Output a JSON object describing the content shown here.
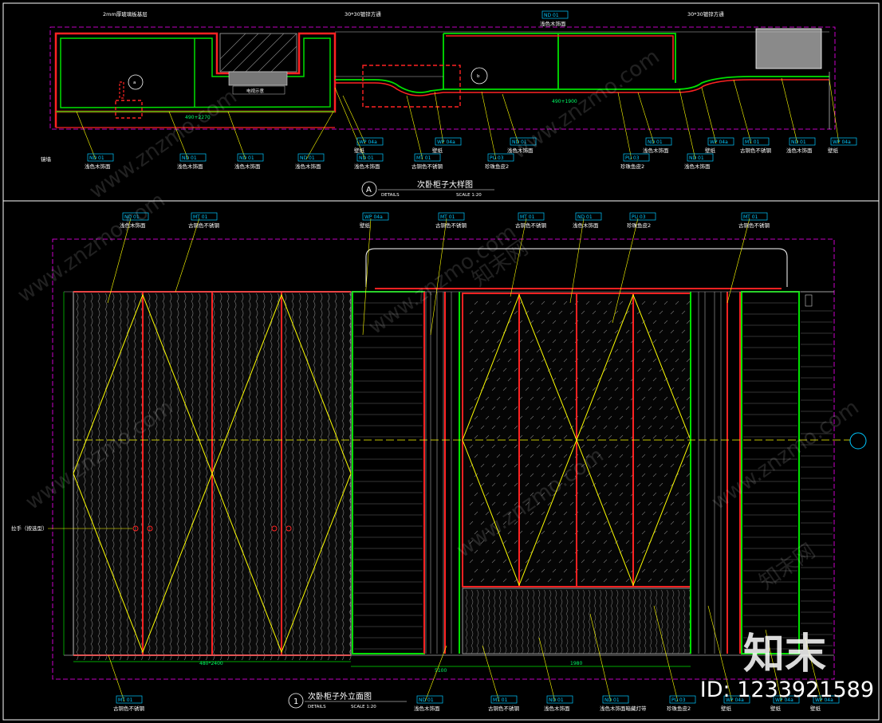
{
  "drawing_a": {
    "title": "次卧柜子大样图",
    "label": "A",
    "details_word": "DETAILS",
    "scale": "SCALE 1:20",
    "top_callouts": [
      "2mm厚玻璃板基层",
      "30*30镀锌方通",
      "30*30镀锌方通"
    ],
    "top_tag": "ND 01",
    "top_tag_text": "浅色木饰面",
    "section_marks": [
      "a",
      "b"
    ],
    "tv_text": "电视示意",
    "dims": [
      "490+2270",
      "490+1900"
    ],
    "left_note": "镜墙",
    "bottom_tags": [
      {
        "code": "ND 01",
        "text": "浅色木饰面"
      },
      {
        "code": "ND 01",
        "text": "浅色木饰面"
      },
      {
        "code": "ND 01",
        "text": "浅色木饰面"
      },
      {
        "code": "ND 01",
        "text": "浅色木饰面"
      },
      {
        "code": "ND 01",
        "text": "浅色木饰面"
      },
      {
        "code": "WP 04a",
        "text": "壁纸"
      },
      {
        "code": "MT 01",
        "text": "古铜色不锈钢"
      },
      {
        "code": "WP 04a",
        "text": "壁纸"
      },
      {
        "code": "PU 03",
        "text": "珍珠鱼皮2"
      },
      {
        "code": "ND 01",
        "text": "浅色木饰面"
      },
      {
        "code": "PU 03",
        "text": "珍珠鱼皮2"
      },
      {
        "code": "ND 01",
        "text": "浅色木饰面"
      },
      {
        "code": "ND 01",
        "text": "浅色木饰面"
      },
      {
        "code": "WP 04a",
        "text": "壁纸"
      },
      {
        "code": "MT 01",
        "text": "古铜色不锈钢"
      },
      {
        "code": "ND 01",
        "text": "浅色木饰面"
      },
      {
        "code": "WP 04a",
        "text": "壁纸"
      }
    ]
  },
  "drawing_1": {
    "title": "次卧柜子外立面图",
    "label": "1",
    "details_word": "DETAILS",
    "scale": "SCALE 1:20",
    "handle_note": "拉手（按选型）",
    "top_tags": [
      {
        "code": "ND 01",
        "text": "浅色木饰面"
      },
      {
        "code": "MT 01",
        "text": "古铜色不锈钢"
      },
      {
        "code": "WP 04a",
        "text": "壁纸"
      },
      {
        "code": "MT 01",
        "text": "古铜色不锈钢"
      },
      {
        "code": "MT 01",
        "text": "古铜色不锈钢"
      },
      {
        "code": "ND 01",
        "text": "浅色木饰面"
      },
      {
        "code": "PU 03",
        "text": "珍珠鱼皮2"
      },
      {
        "code": "MT 01",
        "text": "古铜色不锈钢"
      }
    ],
    "bottom_tags": [
      {
        "code": "MT 01",
        "text": "古铜色不锈钢"
      },
      {
        "code": "ND 01",
        "text": "浅色木饰面"
      },
      {
        "code": "MT 01",
        "text": "古铜色不锈钢"
      },
      {
        "code": "ND 01",
        "text": "浅色木饰面"
      },
      {
        "code": "ND 01",
        "text": "浅色木饰面暗藏灯带"
      },
      {
        "code": "PU 03",
        "text": "珍珠鱼皮2"
      },
      {
        "code": "WP 04a",
        "text": "壁纸"
      },
      {
        "code": "WP 04a",
        "text": "壁纸"
      },
      {
        "code": "WP 04a",
        "text": "壁纸"
      }
    ],
    "dims": [
      "480*2400",
      "5100",
      "1980"
    ]
  },
  "watermark": {
    "text": "www.znzmo.com",
    "brand": "知末网"
  },
  "logo_text": "知末",
  "id_text": "ID: 1233921589"
}
